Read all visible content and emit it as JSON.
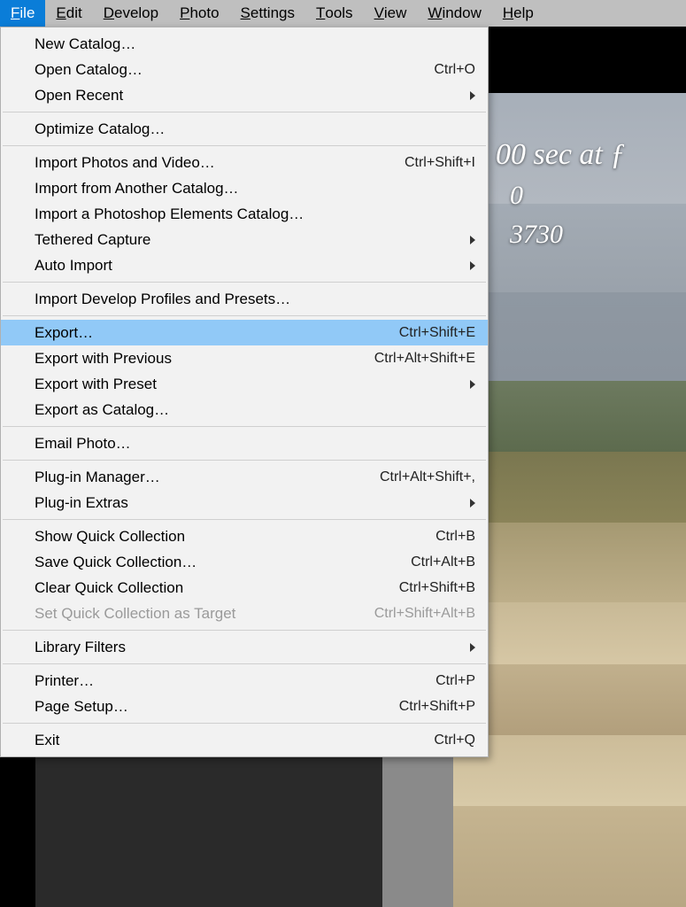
{
  "menubar": [
    {
      "label": "File",
      "mn": "F",
      "active": true
    },
    {
      "label": "Edit",
      "mn": "E",
      "active": false
    },
    {
      "label": "Develop",
      "mn": "D",
      "active": false
    },
    {
      "label": "Photo",
      "mn": "P",
      "active": false
    },
    {
      "label": "Settings",
      "mn": "S",
      "active": false
    },
    {
      "label": "Tools",
      "mn": "T",
      "active": false
    },
    {
      "label": "View",
      "mn": "V",
      "active": false
    },
    {
      "label": "Window",
      "mn": "W",
      "active": false
    },
    {
      "label": "Help",
      "mn": "H",
      "active": false
    }
  ],
  "photo_overlay": {
    "line1": "00 sec at ƒ",
    "line2": "0",
    "line3": "3730"
  },
  "file_menu": [
    {
      "type": "item",
      "label": "New Catalog…"
    },
    {
      "type": "item",
      "label": "Open Catalog…",
      "shortcut": "Ctrl+O"
    },
    {
      "type": "item",
      "label": "Open Recent",
      "submenu": true
    },
    {
      "type": "sep"
    },
    {
      "type": "item",
      "label": "Optimize Catalog…"
    },
    {
      "type": "sep"
    },
    {
      "type": "item",
      "label": "Import Photos and Video…",
      "shortcut": "Ctrl+Shift+I"
    },
    {
      "type": "item",
      "label": "Import from Another Catalog…"
    },
    {
      "type": "item",
      "label": "Import a Photoshop Elements Catalog…"
    },
    {
      "type": "item",
      "label": "Tethered Capture",
      "submenu": true
    },
    {
      "type": "item",
      "label": "Auto Import",
      "submenu": true
    },
    {
      "type": "sep"
    },
    {
      "type": "item",
      "label": "Import Develop Profiles and Presets…"
    },
    {
      "type": "sep"
    },
    {
      "type": "item",
      "label": "Export…",
      "shortcut": "Ctrl+Shift+E",
      "highlight": true
    },
    {
      "type": "item",
      "label": "Export with Previous",
      "shortcut": "Ctrl+Alt+Shift+E"
    },
    {
      "type": "item",
      "label": "Export with Preset",
      "submenu": true
    },
    {
      "type": "item",
      "label": "Export as Catalog…"
    },
    {
      "type": "sep"
    },
    {
      "type": "item",
      "label": "Email Photo…"
    },
    {
      "type": "sep"
    },
    {
      "type": "item",
      "label": "Plug-in Manager…",
      "shortcut": "Ctrl+Alt+Shift+,"
    },
    {
      "type": "item",
      "label": "Plug-in Extras",
      "submenu": true
    },
    {
      "type": "sep"
    },
    {
      "type": "item",
      "label": "Show Quick Collection",
      "shortcut": "Ctrl+B"
    },
    {
      "type": "item",
      "label": "Save Quick Collection…",
      "shortcut": "Ctrl+Alt+B"
    },
    {
      "type": "item",
      "label": "Clear Quick Collection",
      "shortcut": "Ctrl+Shift+B"
    },
    {
      "type": "item",
      "label": "Set Quick Collection as Target",
      "shortcut": "Ctrl+Shift+Alt+B",
      "disabled": true
    },
    {
      "type": "sep"
    },
    {
      "type": "item",
      "label": "Library Filters",
      "submenu": true
    },
    {
      "type": "sep"
    },
    {
      "type": "item",
      "label": "Printer…",
      "shortcut": "Ctrl+P"
    },
    {
      "type": "item",
      "label": "Page Setup…",
      "shortcut": "Ctrl+Shift+P"
    },
    {
      "type": "sep"
    },
    {
      "type": "item",
      "label": "Exit",
      "shortcut": "Ctrl+Q"
    }
  ]
}
